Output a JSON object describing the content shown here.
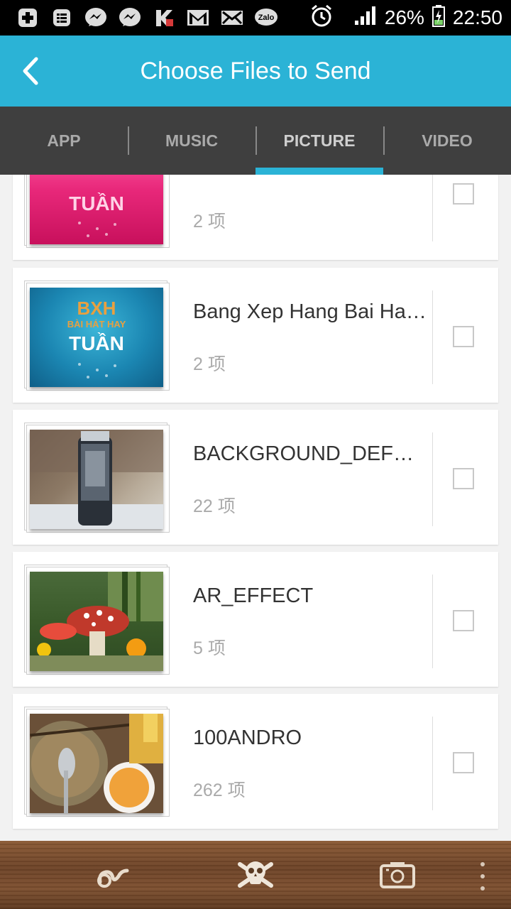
{
  "status_bar": {
    "battery": "26%",
    "time": "22:50",
    "notification_icons": [
      "plus-icon",
      "message-icon",
      "messenger-icon",
      "messenger-icon",
      "kaspersky-icon",
      "gmail-icon",
      "mail-icon",
      "zalo-icon"
    ],
    "zalo_label": "Zalo"
  },
  "app_bar": {
    "title": "Choose Files to Send"
  },
  "tabs": [
    {
      "label": "APP",
      "active": false
    },
    {
      "label": "MUSIC",
      "active": false
    },
    {
      "label": "PICTURE",
      "active": true
    },
    {
      "label": "VIDEO",
      "active": false
    }
  ],
  "folders": [
    {
      "name": "",
      "count": "2 项",
      "thumb_text": "TUẦN"
    },
    {
      "name": "Bang Xep Hang Bai Hat...",
      "count": "2 项",
      "thumb_text_1": "BXH",
      "thumb_text_2": "BÀI HÁT HAY",
      "thumb_text_3": "TUẦN"
    },
    {
      "name": "BACKGROUND_DEFOC...",
      "count": "22 项"
    },
    {
      "name": "AR_EFFECT",
      "count": "5 项"
    },
    {
      "name": "100ANDRO",
      "count": "262 项"
    }
  ],
  "colors": {
    "accent": "#2bb3d6",
    "tab_bar": "#3f3f3f",
    "bottom_wood": "#7a4c2c"
  },
  "bottom_bar": {
    "icons": [
      "shake-icon",
      "skull-crossbones-icon",
      "camera-swap-icon",
      "overflow-menu-icon"
    ]
  }
}
